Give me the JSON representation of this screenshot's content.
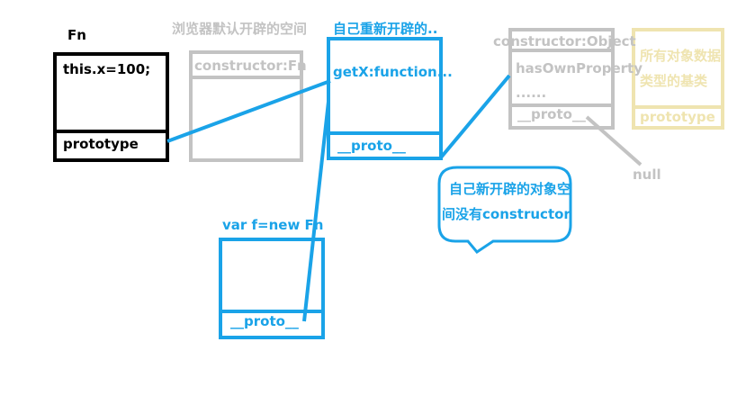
{
  "fn": {
    "title": "Fn",
    "body": "this.x=100;",
    "prototype": "prototype"
  },
  "default_proto": {
    "caption": "浏览器默认开辟的空间",
    "constructor": "constructor:Fn"
  },
  "new_proto": {
    "caption": "自己重新开辟的..",
    "getx": "getX:function...",
    "proto": "__proto__"
  },
  "object_proto": {
    "constructor": "constructor:Object",
    "has_own": "hasOwnProperty",
    "ellipsis": "......",
    "proto": "__proto__",
    "null_label": "null"
  },
  "base_note": {
    "line1": "所有对象数据",
    "line2": "类型的基类",
    "prototype": "prototype"
  },
  "instance": {
    "caption": "var f=new Fn",
    "proto": "__proto__"
  },
  "bubble": {
    "line1": "自己新开辟的对象空",
    "line2": "间没有constructor"
  }
}
